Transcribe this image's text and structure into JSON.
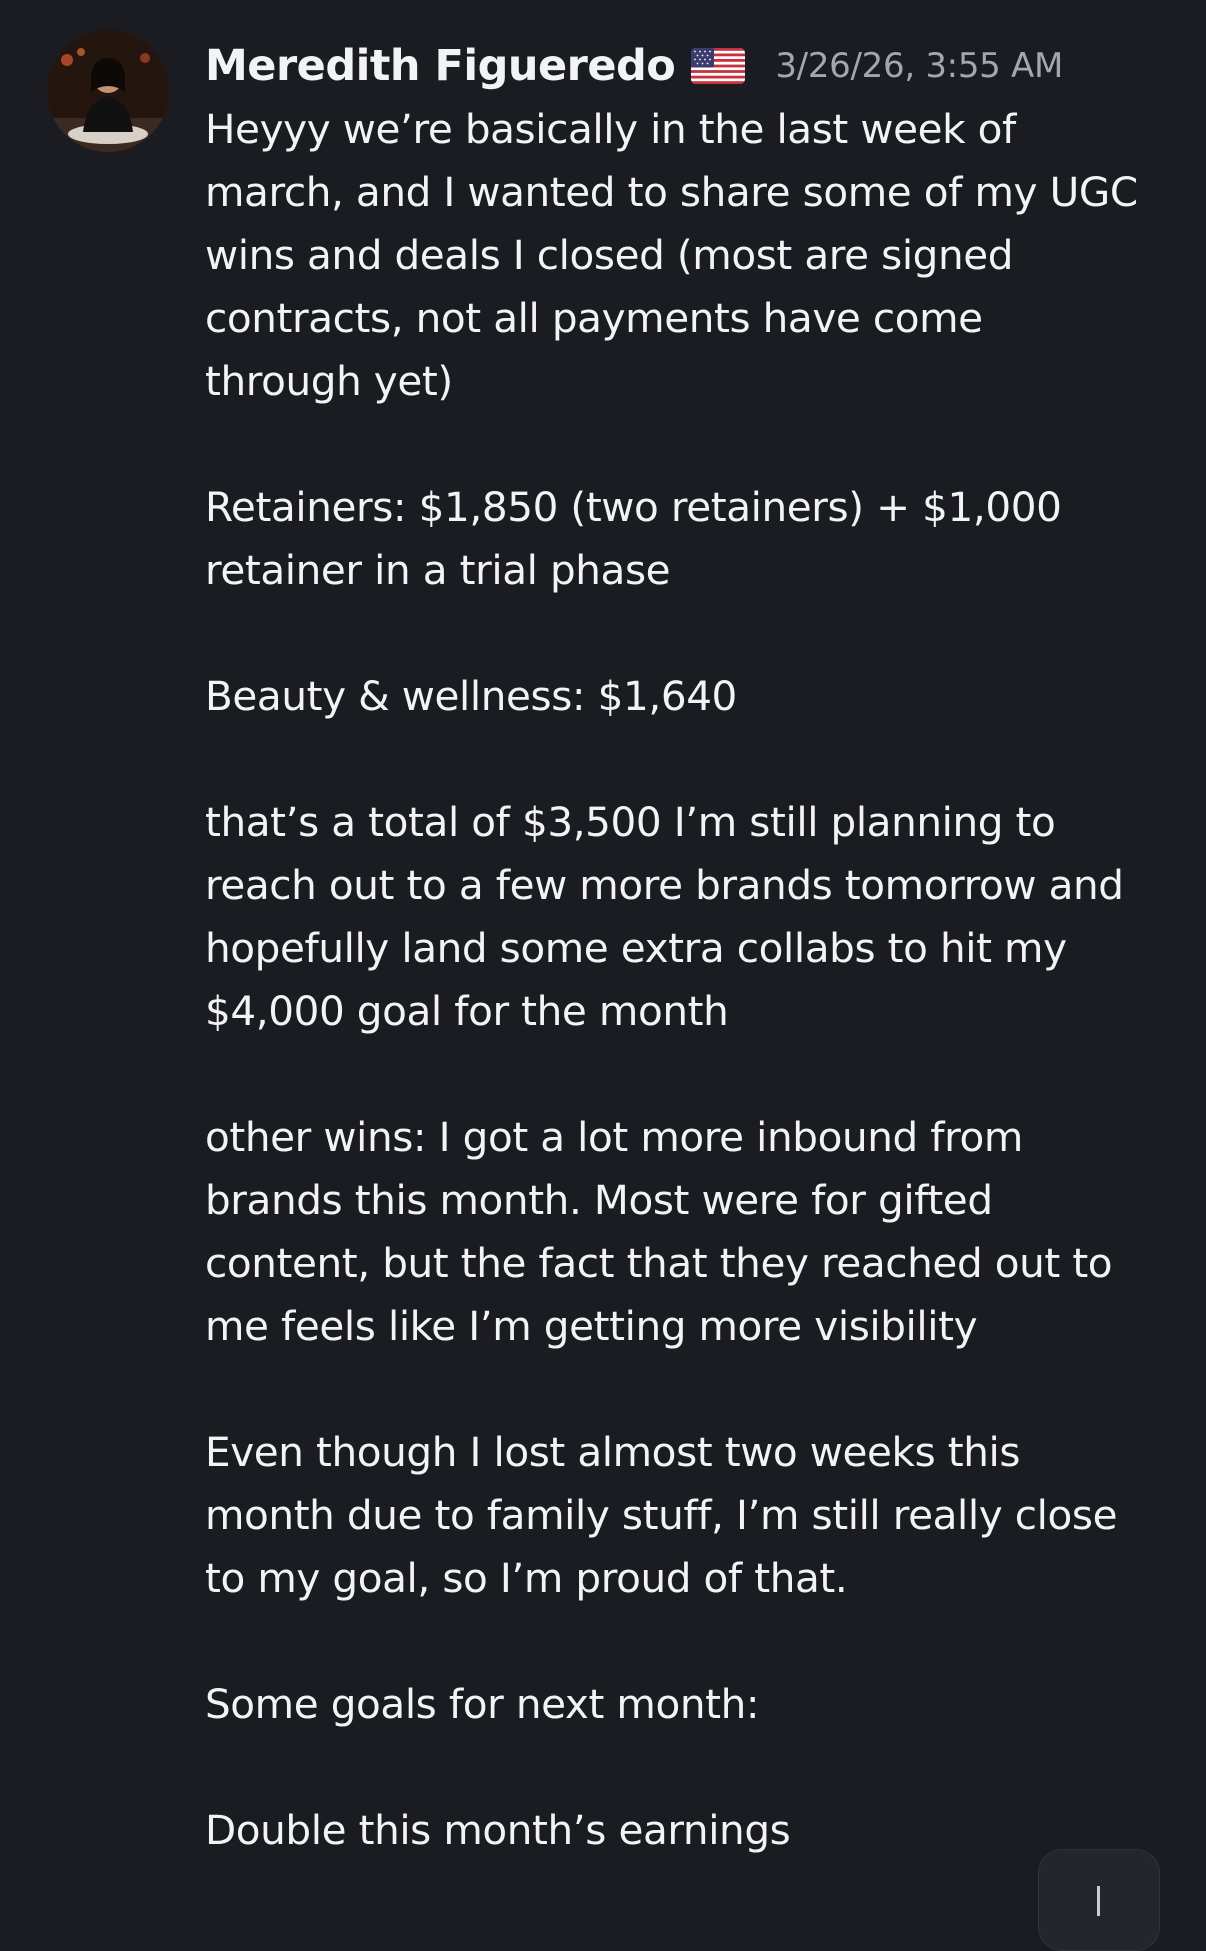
{
  "message": {
    "author": "Meredith Figueredo",
    "flag_icon": "us-flag-icon",
    "timestamp": "3/26/26, 3:55 AM",
    "paragraphs": [
      "Heyyy we’re basically in the last week of\nmarch, and I wanted to share some of my UGC\nwins and deals I closed (most are signed\ncontracts, not all payments have come\nthrough yet)",
      "Retainers: $1,850 (two retainers) + $1,000\nretainer in a trial phase",
      "Beauty & wellness: $1,640",
      "that’s a total of $3,500 I’m still planning to\nreach out to a few more brands tomorrow and\nhopefully land some extra collabs to hit my\n$4,000 goal for the month",
      "other wins: I got a lot more inbound from\nbrands this month. Most were for gifted\ncontent, but the fact that they reached out to\nme feels like I’m getting more visibility",
      "Even though I lost almost two weeks this\nmonth due to family stuff, I’m still really close\nto my goal, so I’m proud of that.",
      "Some goals for next month:",
      "Double this month’s earnings"
    ]
  },
  "colors": {
    "background": "#1b1c21",
    "text": "#f2f3f5",
    "timestamp": "#a3a6ae"
  },
  "scroll_button": {
    "icon": "arrow-down-icon"
  }
}
